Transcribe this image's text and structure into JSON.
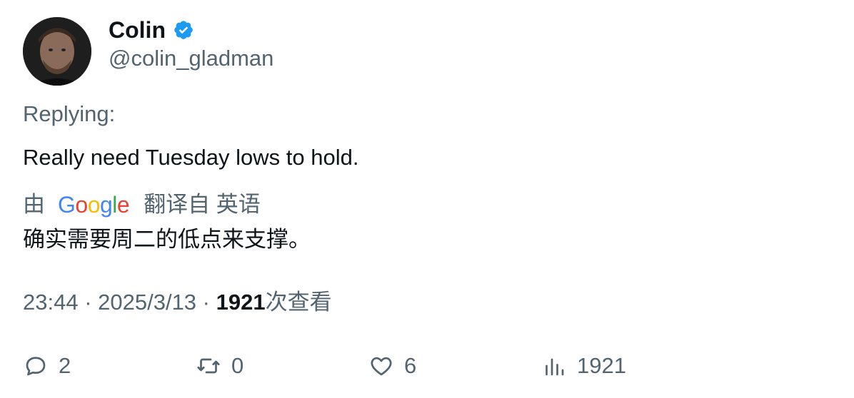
{
  "user": {
    "display_name": "Colin",
    "handle": "@colin_gladman",
    "verified_icon": "verified-badge-icon"
  },
  "tweet": {
    "replying_label": "Replying:",
    "text": "Really need Tuesday lows to hold."
  },
  "translation": {
    "prefix": "由",
    "provider_logo": "Google",
    "suffix": "翻译自 英语",
    "translated_text": "确实需要周二的低点来支撑。"
  },
  "meta": {
    "time": "23:44",
    "separator": " · ",
    "date": "2025/3/13",
    "views_count": "1921",
    "views_label": "次查看"
  },
  "actions": {
    "reply_count": "2",
    "retweet_count": "0",
    "like_count": "6",
    "views_count": "1921"
  },
  "colors": {
    "primary_text": "#0f1419",
    "secondary_text": "#536471",
    "verified_blue": "#1d9bf0"
  }
}
